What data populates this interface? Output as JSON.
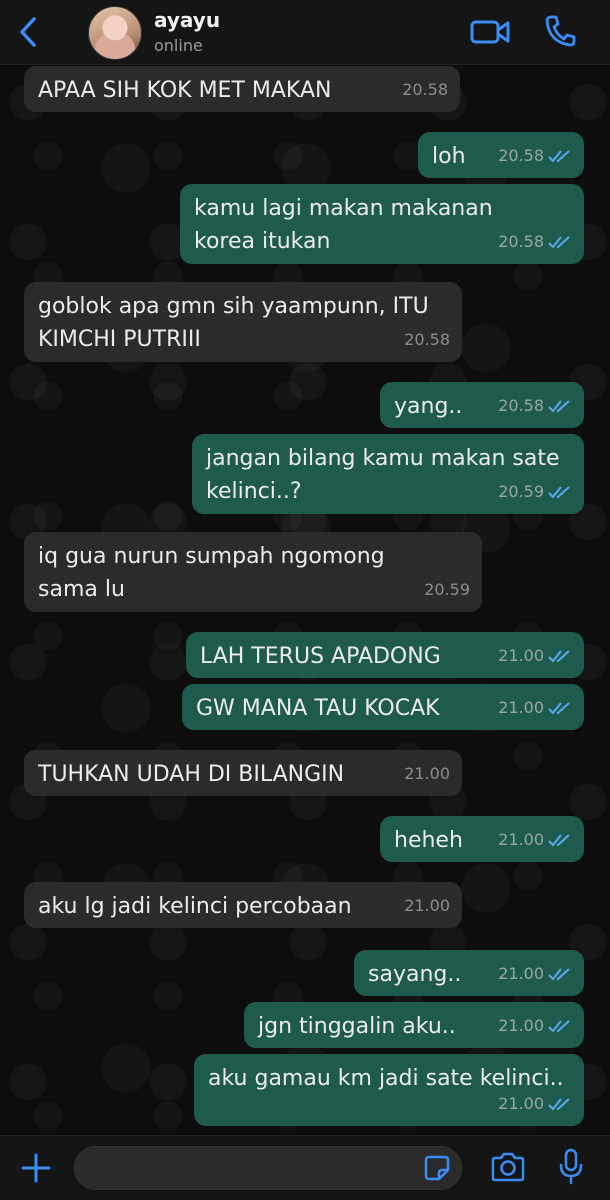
{
  "header": {
    "contact_name": "ayayu",
    "status": "online",
    "accent": "#3b8cf5"
  },
  "messages": [
    {
      "dir": "in",
      "text": "APAA SIH KOK MET MAKAN",
      "time": "20.58"
    },
    {
      "dir": "out",
      "text": "loh",
      "time": "20.58",
      "read": true
    },
    {
      "dir": "out",
      "text": "kamu lagi makan makanan korea itukan",
      "time": "20.58",
      "read": true
    },
    {
      "dir": "in",
      "text": "goblok apa gmn sih yaampunn, ITU KIMCHI PUTRIII",
      "time": "20.58"
    },
    {
      "dir": "out",
      "text": "yang..",
      "time": "20.58",
      "read": true
    },
    {
      "dir": "out",
      "text": "jangan bilang kamu makan sate kelinci..?",
      "time": "20.59",
      "read": true
    },
    {
      "dir": "in",
      "text": "iq gua nurun sumpah ngomong sama lu",
      "time": "20.59"
    },
    {
      "dir": "out",
      "text": "LAH TERUS APADONG",
      "time": "21.00",
      "read": true
    },
    {
      "dir": "out",
      "text": "GW MANA TAU KOCAK",
      "time": "21.00",
      "read": true
    },
    {
      "dir": "in",
      "text": "TUHKAN UDAH DI BILANGIN",
      "time": "21.00"
    },
    {
      "dir": "out",
      "text": "heheh",
      "time": "21.00",
      "read": true
    },
    {
      "dir": "in",
      "text": "aku lg jadi kelinci percobaan",
      "time": "21.00"
    },
    {
      "dir": "out",
      "text": "sayang..",
      "time": "21.00",
      "read": true
    },
    {
      "dir": "out",
      "text": "jgn tinggalin aku..",
      "time": "21.00",
      "read": true
    },
    {
      "dir": "out",
      "text": "aku gamau km jadi sate kelinci..",
      "time": "21.00",
      "read": true
    }
  ],
  "composer": {
    "value": "",
    "placeholder": ""
  },
  "icons": [
    "back-icon",
    "video-call-icon",
    "phone-icon",
    "plus-icon",
    "sticker-icon",
    "camera-icon",
    "mic-icon"
  ],
  "colors": {
    "incoming_bubble": "#2b2b2c",
    "outgoing_bubble": "#1f5b4d",
    "read_ticks": "#5aa7f0"
  }
}
